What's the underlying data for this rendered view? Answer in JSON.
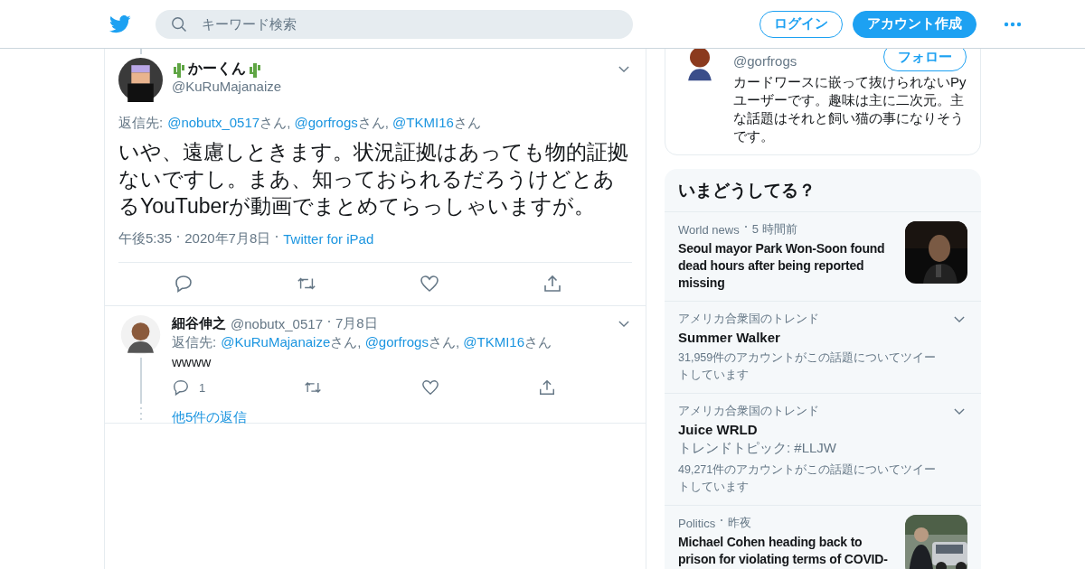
{
  "header": {
    "search": {
      "placeholder": "キーワード検索"
    },
    "login": "ログイン",
    "signup": "アカウント作成"
  },
  "tweet": {
    "name": "かーくん",
    "handle": "@KuRuMajanaize",
    "reply_to": {
      "label": "返信先:",
      "mentions": [
        {
          "handle": "@nobutx_0517",
          "suffix": "さん, "
        },
        {
          "handle": "@gorfrogs",
          "suffix": "さん, "
        },
        {
          "handle": "@TKMI16",
          "suffix": "さん"
        }
      ]
    },
    "text": "いや、遠慮しときます。状況証拠はあっても物的証拠ないですし。まあ、知っておられるだろうけどとあるYouTuberが動画でまとめてらっしゃいますが。",
    "time": "午後5:35",
    "date": "2020年7月8日",
    "source": "Twitter for iPad"
  },
  "reply": {
    "name": "細谷伸之",
    "handle": "@nobutx_0517",
    "date": "7月8日",
    "reply_to": {
      "label": "返信先:",
      "mentions": [
        {
          "handle": "@KuRuMajanaize",
          "suffix": "さん, "
        },
        {
          "handle": "@gorfrogs",
          "suffix": "さん, "
        },
        {
          "handle": "@TKMI16",
          "suffix": "さん"
        }
      ]
    },
    "text": "wwww",
    "reply_count": "1",
    "more_replies": "他5件の返信"
  },
  "profile_card": {
    "handle": "@gorfrogs",
    "follow": "フォロー",
    "bio": "カードワースに嵌って抜けられないPyユーザーです。趣味は主に二次元。主な話題はそれと飼い猫の事になりそうです。"
  },
  "trends": {
    "title": "いまどうしてる？",
    "items": [
      {
        "kind": "news",
        "context": "World news",
        "time": "5 時間前",
        "title": "Seoul mayor Park Won-Soon found dead hours after being reported missing"
      },
      {
        "kind": "trend",
        "context": "アメリカ合衆国のトレンド",
        "title": "Summer Walker",
        "count": "31,959件のアカウントがこの話題についてツイートしています"
      },
      {
        "kind": "trend",
        "context": "アメリカ合衆国のトレンド",
        "title": "Juice WRLD",
        "topic": "トレンドトピック: #LLJW",
        "count": "49,271件のアカウントがこの話題についてツイートしています"
      },
      {
        "kind": "news",
        "context": "Politics",
        "time": "昨夜",
        "title": "Michael Cohen heading back to prison for violating terms of COVID-"
      }
    ]
  }
}
